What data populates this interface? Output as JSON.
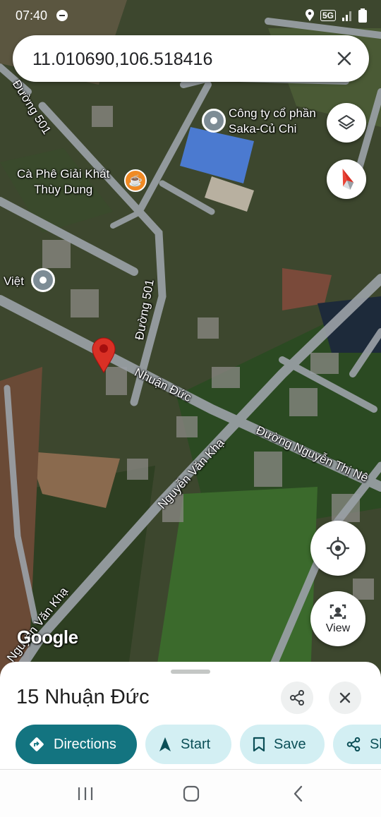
{
  "status_bar": {
    "time": "07:40",
    "network": "5G"
  },
  "search": {
    "query": "11.010690,106.518416"
  },
  "map": {
    "road_labels": {
      "duong_501_top": "Đường 501",
      "duong_501_mid": "Đường 501",
      "nhuan_duc": "Nhuận Đức",
      "nguyen_van_kha_mid": "Nguyễn Văn Khạ",
      "nguyen_van_kha_bottom": "Nguyễn Văn Khạ",
      "nguyen_thi_ne": "Đường Nguyễn Thị Nê"
    },
    "pois": {
      "company": "Công ty cổ phần\nSaka-Củ Chi",
      "cafe": "Cà Phê Giải Khát\nThùy Dung",
      "viet": "Việt"
    },
    "logo": "Google",
    "view_button_label": "View"
  },
  "place": {
    "title": "15 Nhuận Đức"
  },
  "actions": {
    "directions": "Directions",
    "start": "Start",
    "save": "Save",
    "share": "Share"
  },
  "colors": {
    "primary": "#137480",
    "secondary": "#d3eff3",
    "pin": "#d93025",
    "cafe": "#f08a24"
  },
  "icons": {
    "clear": "close-icon",
    "layers": "layers-icon",
    "compass": "compass-icon",
    "location": "my-location-icon",
    "view": "street-view-icon",
    "share": "share-icon",
    "close": "close-icon",
    "directions": "directions-icon",
    "start": "navigation-arrow-icon",
    "save": "bookmark-icon",
    "nav_recent": "recent-apps-icon",
    "nav_home": "home-icon",
    "nav_back": "back-icon"
  }
}
